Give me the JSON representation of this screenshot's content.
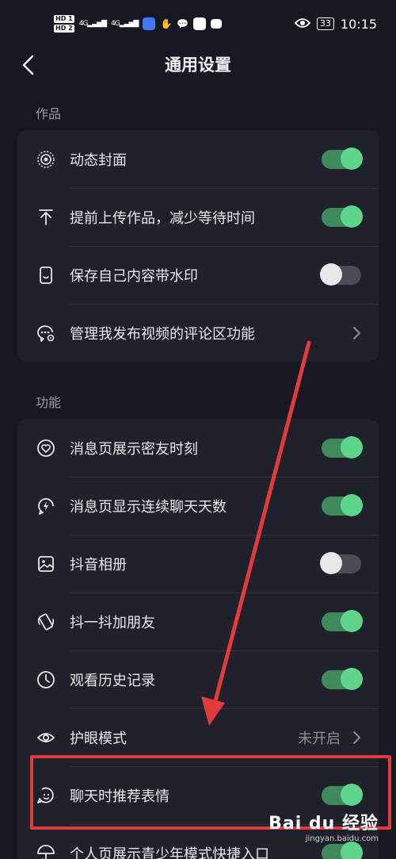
{
  "status": {
    "hd1": "HD 1",
    "hd2": "HD 2",
    "net1": "4G",
    "net2": "4G",
    "battery": "33",
    "time": "10:15"
  },
  "header": {
    "title": "通用设置"
  },
  "sections": {
    "works": {
      "label": "作品",
      "rows": [
        {
          "label": "动态封面",
          "icon": "live-cover-icon",
          "state": "on"
        },
        {
          "label": "提前上传作品，减少等待时间",
          "icon": "upload-icon",
          "state": "on"
        },
        {
          "label": "保存自己内容带水印",
          "icon": "phone-watermark-icon",
          "state": "off"
        },
        {
          "label": "管理我发布视频的评论区功能",
          "icon": "comment-settings-icon",
          "state": "link"
        }
      ]
    },
    "features": {
      "label": "功能",
      "rows": [
        {
          "label": "消息页展示密友时刻",
          "icon": "heart-circle-icon",
          "state": "on"
        },
        {
          "label": "消息页显示连续聊天天数",
          "icon": "flame-bubble-icon",
          "state": "on"
        },
        {
          "label": "抖音相册",
          "icon": "photo-album-icon",
          "state": "off"
        },
        {
          "label": "抖一抖加朋友",
          "icon": "shake-phone-icon",
          "state": "on"
        },
        {
          "label": "观看历史记录",
          "icon": "clock-icon",
          "state": "on"
        },
        {
          "label": "护眼模式",
          "icon": "eye-icon",
          "state": "link",
          "value": "未开启"
        },
        {
          "label": "聊天时推荐表情",
          "icon": "emoji-bubble-icon",
          "state": "on"
        },
        {
          "label": "个人页展示青少年模式快捷入口",
          "icon": "umbrella-icon",
          "state": "on"
        }
      ]
    }
  },
  "watermark": {
    "brand": "Bai du 经验",
    "url": "jingyan.baidu.com"
  },
  "colors": {
    "background": "#161823",
    "card": "#1f212c",
    "toggle_on": "#5fd48b",
    "annotation": "#e33b3b"
  }
}
